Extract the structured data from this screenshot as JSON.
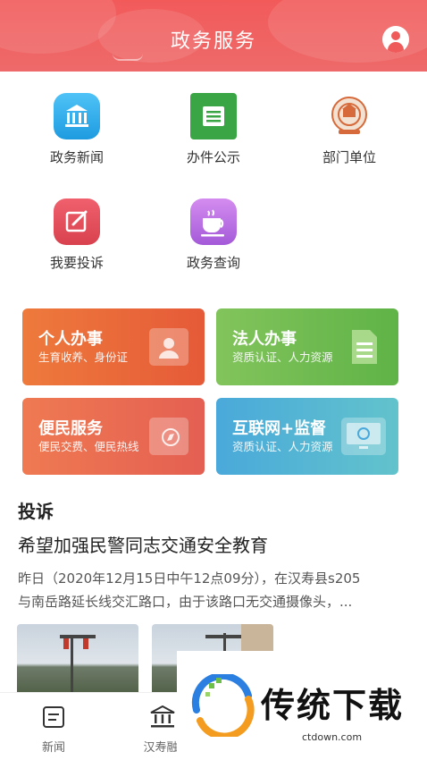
{
  "header": {
    "title": "政务服务"
  },
  "grid": [
    {
      "label": "政务新闻",
      "icon": "government-building-icon"
    },
    {
      "label": "办件公示",
      "icon": "document-board-icon"
    },
    {
      "label": "部门单位",
      "icon": "national-emblem-icon"
    },
    {
      "label": "我要投诉",
      "icon": "edit-pencil-icon"
    },
    {
      "label": "政务查询",
      "icon": "coffee-cup-icon"
    }
  ],
  "cards": [
    {
      "title": "个人办事",
      "sub": "生育收养、身份证",
      "icon": "id-card-icon"
    },
    {
      "title": "法人办事",
      "sub": "资质认证、人力资源",
      "icon": "document-icon"
    },
    {
      "title": "便民服务",
      "sub": "便民交费、便民热线",
      "icon": "compass-folder-icon"
    },
    {
      "title": "互联网+监督",
      "sub": "资质认证、人力资源",
      "icon": "monitor-icon"
    }
  ],
  "complaint": {
    "section_title": "投诉",
    "post_title": "希望加强民警同志交通安全教育",
    "body_line1": "昨日（2020年12月15日中午12点09分），在汉寿县s205",
    "body_line2": "与南岳路延长线交汇路口，由于该路口无交通摄像头，..."
  },
  "bottom_nav": [
    {
      "label": "新闻",
      "icon": "news-icon"
    },
    {
      "label": "汉寿融",
      "icon": "bank-icon"
    }
  ],
  "watermark": {
    "text": "传统下载",
    "url": "ctdown.com"
  },
  "colors": {
    "header": "#f25a5a",
    "accent_red": "#ef5b5b"
  }
}
